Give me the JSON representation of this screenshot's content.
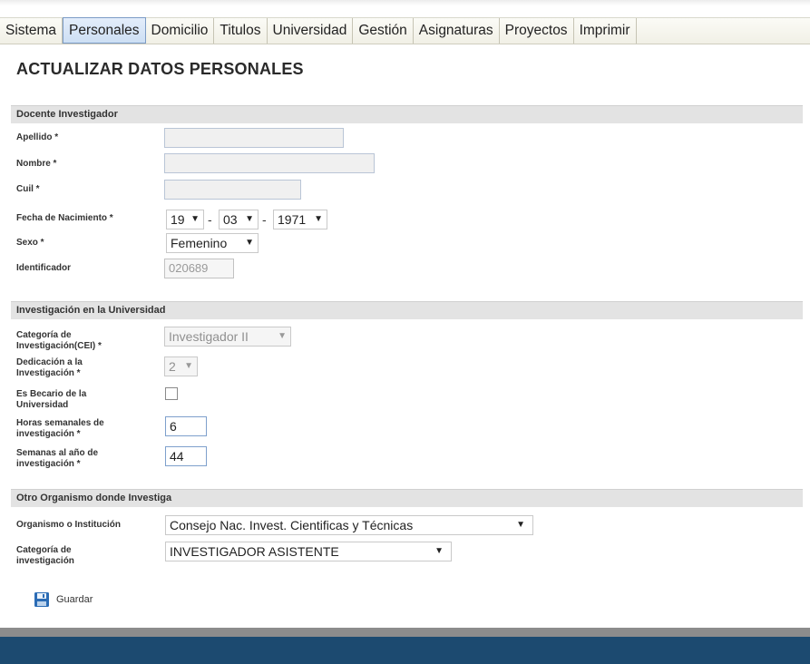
{
  "tabs": [
    {
      "label": "Sistema",
      "active": false
    },
    {
      "label": "Personales",
      "active": true
    },
    {
      "label": "Domicilio",
      "active": false
    },
    {
      "label": "Titulos",
      "active": false
    },
    {
      "label": "Universidad",
      "active": false
    },
    {
      "label": "Gestión",
      "active": false
    },
    {
      "label": "Asignaturas",
      "active": false
    },
    {
      "label": "Proyectos",
      "active": false
    },
    {
      "label": "Imprimir",
      "active": false
    }
  ],
  "page_title": "ACTUALIZAR DATOS PERSONALES",
  "docente": {
    "header": "Docente Investigador",
    "apellido_label": "Apellido *",
    "apellido_value": "",
    "nombre_label": "Nombre *",
    "nombre_value": "",
    "cuil_label": "Cuil *",
    "cuil_value": "",
    "fecha_label": "Fecha de Nacimiento *",
    "fecha_day": "19",
    "fecha_month": "03",
    "fecha_year": "1971",
    "date_separator": "-",
    "sexo_label": "Sexo *",
    "sexo_value": "Femenino",
    "identificador_label": "Identificador",
    "identificador_value": "020689"
  },
  "universidad": {
    "header": "Investigación en la Universidad",
    "categoria_label_1": "Categoría de",
    "categoria_label_2": "Investigación(CEI) *",
    "categoria_value": "Investigador II",
    "dedicacion_label_1": "Dedicación a la",
    "dedicacion_label_2": "Investigación *",
    "dedicacion_value": "2",
    "becario_label_1": "Es Becario de la",
    "becario_label_2": "Universidad",
    "becario_checked": false,
    "horas_label_1": "Horas semanales de",
    "horas_label_2": "investigación *",
    "horas_value": "6",
    "semanas_label_1": "Semanas al año de",
    "semanas_label_2": "investigación *",
    "semanas_value": "44"
  },
  "otro": {
    "header": "Otro Organismo donde Investiga",
    "organismo_label": "Organismo o Institución",
    "organismo_value": "Consejo Nac. Invest. Cientificas y Técnicas",
    "categoria_label_1": "Categoría de",
    "categoria_label_2": "investigación",
    "categoria_value": "INVESTIGADOR ASISTENTE"
  },
  "save_label": "Guardar",
  "icons": {
    "dropdown": "triangle-down",
    "save": "floppy-disk"
  },
  "colors": {
    "active_tab": "#cddff4",
    "section_bg": "#e3e3e3",
    "footer": "#1c4a70"
  }
}
